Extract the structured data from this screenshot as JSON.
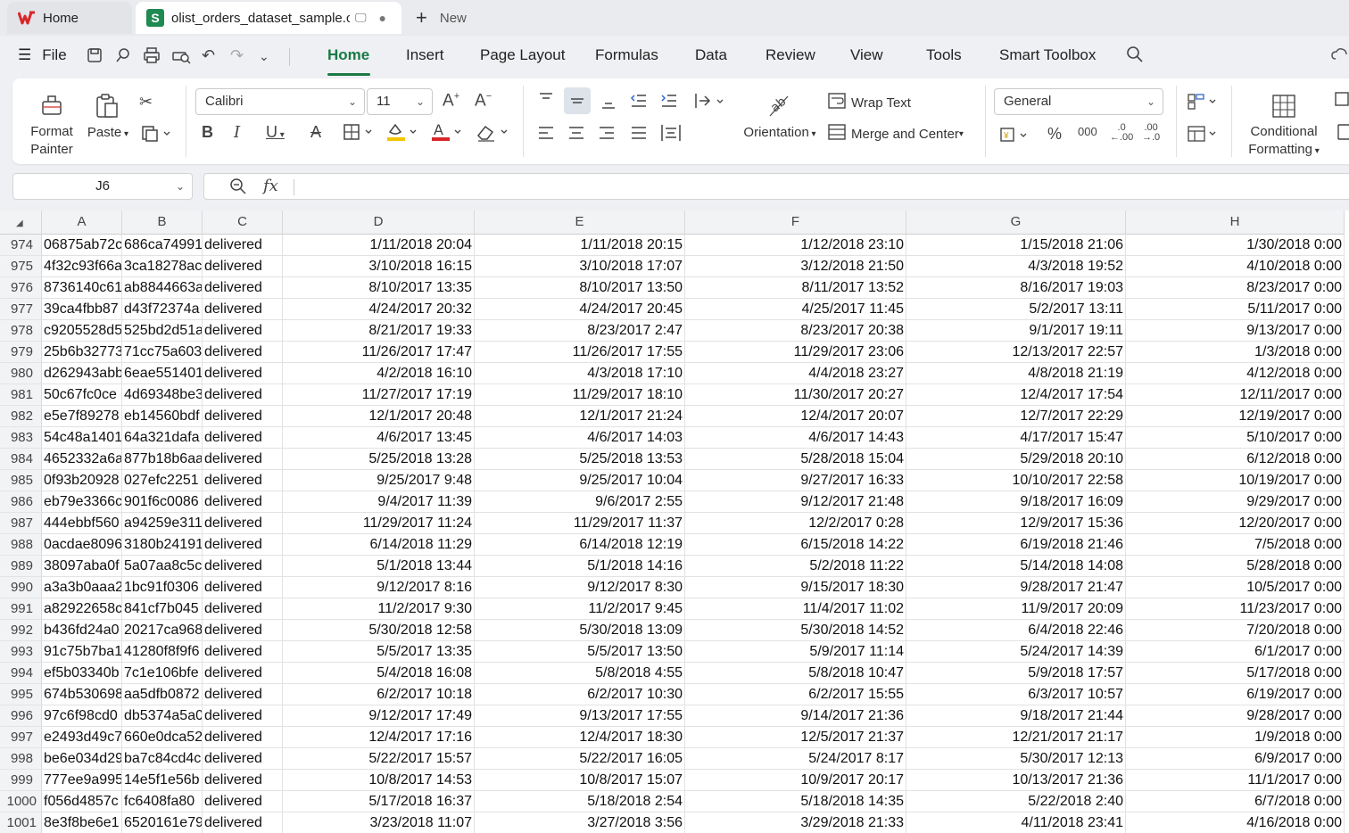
{
  "tabs": {
    "home": "Home",
    "file": "olist_orders_dataset_sample.c",
    "file_logo": "S",
    "new": "New"
  },
  "menu": {
    "file": "File",
    "items": [
      "Home",
      "Insert",
      "Page Layout",
      "Formulas",
      "Data",
      "Review",
      "View",
      "Tools",
      "Smart Toolbox"
    ],
    "active": "Home"
  },
  "ribbon": {
    "format_painter_1": "Format",
    "format_painter_2": "Painter",
    "paste": "Paste",
    "font_name": "Calibri",
    "font_size": "11",
    "wrap_text": "Wrap Text",
    "orientation": "Orientation",
    "merge_center": "Merge and Center",
    "number_format": "General",
    "conditional_1": "Conditional",
    "conditional_2": "Formatting"
  },
  "formula_bar": {
    "name_box": "J6",
    "fx": "fx",
    "value": ""
  },
  "columns": [
    "A",
    "B",
    "C",
    "D",
    "E",
    "F",
    "G",
    "H"
  ],
  "rows": [
    {
      "n": "974",
      "a": "06875ab72c",
      "b": "686ca74991",
      "c": "delivered",
      "d": "1/11/2018 20:04",
      "e": "1/11/2018 20:15",
      "f": "1/12/2018 23:10",
      "g": "1/15/2018 21:06",
      "h": "1/30/2018 0:00"
    },
    {
      "n": "975",
      "a": "4f32c93f66a",
      "b": "3ca18278ac",
      "c": "delivered",
      "d": "3/10/2018 16:15",
      "e": "3/10/2018 17:07",
      "f": "3/12/2018 21:50",
      "g": "4/3/2018 19:52",
      "h": "4/10/2018 0:00"
    },
    {
      "n": "976",
      "a": "8736140c61",
      "b": "ab8844663a",
      "c": "delivered",
      "d": "8/10/2017 13:35",
      "e": "8/10/2017 13:50",
      "f": "8/11/2017 13:52",
      "g": "8/16/2017 19:03",
      "h": "8/23/2017 0:00"
    },
    {
      "n": "977",
      "a": "39ca4fbb87",
      "b": "d43f72374a",
      "c": "delivered",
      "d": "4/24/2017 20:32",
      "e": "4/24/2017 20:45",
      "f": "4/25/2017 11:45",
      "g": "5/2/2017 13:11",
      "h": "5/11/2017 0:00"
    },
    {
      "n": "978",
      "a": "c9205528d5",
      "b": "525bd2d51a",
      "c": "delivered",
      "d": "8/21/2017 19:33",
      "e": "8/23/2017 2:47",
      "f": "8/23/2017 20:38",
      "g": "9/1/2017 19:11",
      "h": "9/13/2017 0:00"
    },
    {
      "n": "979",
      "a": "25b6b32773",
      "b": "71cc75a603",
      "c": "delivered",
      "d": "11/26/2017 17:47",
      "e": "11/26/2017 17:55",
      "f": "11/29/2017 23:06",
      "g": "12/13/2017 22:57",
      "h": "1/3/2018 0:00"
    },
    {
      "n": "980",
      "a": "d262943abb",
      "b": "6eae551401",
      "c": "delivered",
      "d": "4/2/2018 16:10",
      "e": "4/3/2018 17:10",
      "f": "4/4/2018 23:27",
      "g": "4/8/2018 21:19",
      "h": "4/12/2018 0:00"
    },
    {
      "n": "981",
      "a": "50c67fc0ce",
      "b": "4d69348be3",
      "c": "delivered",
      "d": "11/27/2017 17:19",
      "e": "11/29/2017 18:10",
      "f": "11/30/2017 20:27",
      "g": "12/4/2017 17:54",
      "h": "12/11/2017 0:00"
    },
    {
      "n": "982",
      "a": "e5e7f89278",
      "b": "eb14560bdf",
      "c": "delivered",
      "d": "12/1/2017 20:48",
      "e": "12/1/2017 21:24",
      "f": "12/4/2017 20:07",
      "g": "12/7/2017 22:29",
      "h": "12/19/2017 0:00"
    },
    {
      "n": "983",
      "a": "54c48a1401",
      "b": "64a321dafa",
      "c": "delivered",
      "d": "4/6/2017 13:45",
      "e": "4/6/2017 14:03",
      "f": "4/6/2017 14:43",
      "g": "4/17/2017 15:47",
      "h": "5/10/2017 0:00"
    },
    {
      "n": "984",
      "a": "4652332a6a",
      "b": "877b18b6aa",
      "c": "delivered",
      "d": "5/25/2018 13:28",
      "e": "5/25/2018 13:53",
      "f": "5/28/2018 15:04",
      "g": "5/29/2018 20:10",
      "h": "6/12/2018 0:00"
    },
    {
      "n": "985",
      "a": "0f93b20928",
      "b": "027efc2251",
      "c": "delivered",
      "d": "9/25/2017 9:48",
      "e": "9/25/2017 10:04",
      "f": "9/27/2017 16:33",
      "g": "10/10/2017 22:58",
      "h": "10/19/2017 0:00"
    },
    {
      "n": "986",
      "a": "eb79e3366c",
      "b": "901f6c0086",
      "c": "delivered",
      "d": "9/4/2017 11:39",
      "e": "9/6/2017 2:55",
      "f": "9/12/2017 21:48",
      "g": "9/18/2017 16:09",
      "h": "9/29/2017 0:00"
    },
    {
      "n": "987",
      "a": "444ebbf560",
      "b": "a94259e311",
      "c": "delivered",
      "d": "11/29/2017 11:24",
      "e": "11/29/2017 11:37",
      "f": "12/2/2017 0:28",
      "g": "12/9/2017 15:36",
      "h": "12/20/2017 0:00"
    },
    {
      "n": "988",
      "a": "0acdae8096",
      "b": "3180b24191",
      "c": "delivered",
      "d": "6/14/2018 11:29",
      "e": "6/14/2018 12:19",
      "f": "6/15/2018 14:22",
      "g": "6/19/2018 21:46",
      "h": "7/5/2018 0:00"
    },
    {
      "n": "989",
      "a": "38097aba0f",
      "b": "5a07aa8c5c",
      "c": "delivered",
      "d": "5/1/2018 13:44",
      "e": "5/1/2018 14:16",
      "f": "5/2/2018 11:22",
      "g": "5/14/2018 14:08",
      "h": "5/28/2018 0:00"
    },
    {
      "n": "990",
      "a": "a3a3b0aaa2",
      "b": "1bc91f0306",
      "c": "delivered",
      "d": "9/12/2017 8:16",
      "e": "9/12/2017 8:30",
      "f": "9/15/2017 18:30",
      "g": "9/28/2017 21:47",
      "h": "10/5/2017 0:00"
    },
    {
      "n": "991",
      "a": "a82922658c",
      "b": "841cf7b045",
      "c": "delivered",
      "d": "11/2/2017 9:30",
      "e": "11/2/2017 9:45",
      "f": "11/4/2017 11:02",
      "g": "11/9/2017 20:09",
      "h": "11/23/2017 0:00"
    },
    {
      "n": "992",
      "a": "b436fd24a0",
      "b": "20217ca968",
      "c": "delivered",
      "d": "5/30/2018 12:58",
      "e": "5/30/2018 13:09",
      "f": "5/30/2018 14:52",
      "g": "6/4/2018 22:46",
      "h": "7/20/2018 0:00"
    },
    {
      "n": "993",
      "a": "91c75b7ba1",
      "b": "41280f8f9f6",
      "c": "delivered",
      "d": "5/5/2017 13:35",
      "e": "5/5/2017 13:50",
      "f": "5/9/2017 11:14",
      "g": "5/24/2017 14:39",
      "h": "6/1/2017 0:00"
    },
    {
      "n": "994",
      "a": "ef5b03340b",
      "b": "7c1e106bfe",
      "c": "delivered",
      "d": "5/4/2018 16:08",
      "e": "5/8/2018 4:55",
      "f": "5/8/2018 10:47",
      "g": "5/9/2018 17:57",
      "h": "5/17/2018 0:00"
    },
    {
      "n": "995",
      "a": "674b530698",
      "b": "aa5dfb0872",
      "c": "delivered",
      "d": "6/2/2017 10:18",
      "e": "6/2/2017 10:30",
      "f": "6/2/2017 15:55",
      "g": "6/3/2017 10:57",
      "h": "6/19/2017 0:00"
    },
    {
      "n": "996",
      "a": "97c6f98cd0",
      "b": "db5374a5a0",
      "c": "delivered",
      "d": "9/12/2017 17:49",
      "e": "9/13/2017 17:55",
      "f": "9/14/2017 21:36",
      "g": "9/18/2017 21:44",
      "h": "9/28/2017 0:00"
    },
    {
      "n": "997",
      "a": "e2493d49c7",
      "b": "660e0dca52",
      "c": "delivered",
      "d": "12/4/2017 17:16",
      "e": "12/4/2017 18:30",
      "f": "12/5/2017 21:37",
      "g": "12/21/2017 21:17",
      "h": "1/9/2018 0:00"
    },
    {
      "n": "998",
      "a": "be6e034d29",
      "b": "ba7c84cd4c",
      "c": "delivered",
      "d": "5/22/2017 15:57",
      "e": "5/22/2017 16:05",
      "f": "5/24/2017 8:17",
      "g": "5/30/2017 12:13",
      "h": "6/9/2017 0:00"
    },
    {
      "n": "999",
      "a": "777ee9a995",
      "b": "14e5f1e56b",
      "c": "delivered",
      "d": "10/8/2017 14:53",
      "e": "10/8/2017 15:07",
      "f": "10/9/2017 20:17",
      "g": "10/13/2017 21:36",
      "h": "11/1/2017 0:00"
    },
    {
      "n": "1000",
      "a": "f056d4857c",
      "b": "fc6408fa80",
      "c": "delivered",
      "d": "5/17/2018 16:37",
      "e": "5/18/2018 2:54",
      "f": "5/18/2018 14:35",
      "g": "5/22/2018 2:40",
      "h": "6/7/2018 0:00"
    },
    {
      "n": "1001",
      "a": "8e3f8be6e1",
      "b": "6520161e79",
      "c": "delivered",
      "d": "3/23/2018 11:07",
      "e": "3/27/2018 3:56",
      "f": "3/29/2018 21:33",
      "g": "4/11/2018 23:41",
      "h": "4/16/2018 0:00"
    }
  ],
  "colors": {
    "accent": "#1a7a45",
    "ribbon_bg": "#ffffff",
    "chrome_bg": "#eef0f3"
  }
}
